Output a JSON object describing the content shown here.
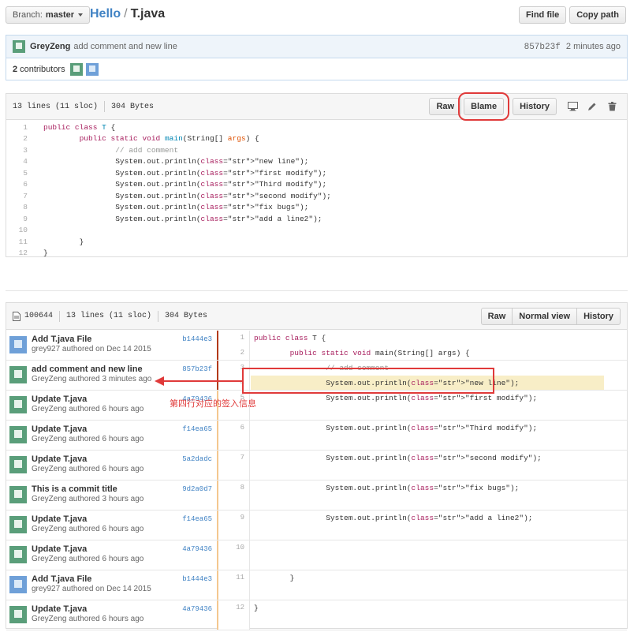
{
  "header": {
    "branch_label": "Branch:",
    "branch_name": "master",
    "repo": "Hello",
    "separator": "/",
    "file": "T.java",
    "find_file": "Find file",
    "copy_path": "Copy path"
  },
  "latest_commit": {
    "author": "GreyZeng",
    "message": "add comment and new line",
    "sha": "857b23f",
    "time": "2 minutes ago"
  },
  "contributors": {
    "count": "2",
    "label": "contributors"
  },
  "file_info": {
    "lines": "13 lines (11 sloc)",
    "size": "304 Bytes",
    "raw": "Raw",
    "blame": "Blame",
    "history": "History"
  },
  "code_lines": [
    {
      "n": "1",
      "text": "public class T {"
    },
    {
      "n": "2",
      "text": "        public static void main(String[] args) {"
    },
    {
      "n": "3",
      "text": "                // add comment"
    },
    {
      "n": "4",
      "text": "                System.out.println(\"new line\");"
    },
    {
      "n": "5",
      "text": "                System.out.println(\"first modify\");"
    },
    {
      "n": "6",
      "text": "                System.out.println(\"Third modify\");"
    },
    {
      "n": "7",
      "text": "                System.out.println(\"second modify\");"
    },
    {
      "n": "8",
      "text": "                System.out.println(\"fix bugs\");"
    },
    {
      "n": "9",
      "text": "                System.out.println(\"add a line2\");"
    },
    {
      "n": "10",
      "text": ""
    },
    {
      "n": "11",
      "text": "        }"
    },
    {
      "n": "12",
      "text": "}"
    }
  ],
  "blame_info": {
    "mode": "100644",
    "lines": "13 lines (11 sloc)",
    "size": "304 Bytes",
    "raw": "Raw",
    "normal_view": "Normal view",
    "history": "History"
  },
  "blame_rows": [
    {
      "title": "Add T.java File",
      "meta": "grey927 authored on Dec 14 2015",
      "sha": "b1444e3",
      "avatar": "blue",
      "bar": "dark",
      "lines": [
        {
          "n": "1",
          "code": "public class T {"
        },
        {
          "n": "2",
          "code": "        public static void main(String[] args) {"
        }
      ]
    },
    {
      "title": "add comment and new line",
      "meta": "GreyZeng authored 3 minutes ago",
      "sha": "857b23f",
      "avatar": "green",
      "bar": "dark",
      "lines": [
        {
          "n": "3",
          "code": "                // add comment"
        },
        {
          "n": "4",
          "code": "                System.out.println(\"new line\");"
        }
      ]
    },
    {
      "title": "Update T.java",
      "meta": "GreyZeng authored 6 hours ago",
      "sha": "4a79436",
      "avatar": "green",
      "bar": "light",
      "lines": [
        {
          "n": "5",
          "code": "                System.out.println(\"first modify\");"
        }
      ]
    },
    {
      "title": "Update T.java",
      "meta": "GreyZeng authored 6 hours ago",
      "sha": "f14ea65",
      "avatar": "green",
      "bar": "light",
      "lines": [
        {
          "n": "6",
          "code": "                System.out.println(\"Third modify\");"
        }
      ]
    },
    {
      "title": "Update T.java",
      "meta": "GreyZeng authored 6 hours ago",
      "sha": "5a2dadc",
      "avatar": "green",
      "bar": "light",
      "lines": [
        {
          "n": "7",
          "code": "                System.out.println(\"second modify\");"
        }
      ]
    },
    {
      "title": "This is a commit title",
      "meta": "GreyZeng authored 3 hours ago",
      "sha": "9d2a0d7",
      "avatar": "green",
      "bar": "light",
      "lines": [
        {
          "n": "8",
          "code": "                System.out.println(\"fix bugs\");"
        }
      ]
    },
    {
      "title": "Update T.java",
      "meta": "GreyZeng authored 6 hours ago",
      "sha": "f14ea65",
      "avatar": "green",
      "bar": "light",
      "lines": [
        {
          "n": "9",
          "code": "                System.out.println(\"add a line2\");"
        }
      ]
    },
    {
      "title": "Update T.java",
      "meta": "GreyZeng authored 6 hours ago",
      "sha": "4a79436",
      "avatar": "green",
      "bar": "light",
      "lines": [
        {
          "n": "10",
          "code": ""
        }
      ]
    },
    {
      "title": "Add T.java File",
      "meta": "grey927 authored on Dec 14 2015",
      "sha": "b1444e3",
      "avatar": "blue",
      "bar": "light",
      "lines": [
        {
          "n": "11",
          "code": "        }"
        }
      ]
    },
    {
      "title": "Update T.java",
      "meta": "GreyZeng authored 6 hours ago",
      "sha": "4a79436",
      "avatar": "green",
      "bar": "light",
      "lines": [
        {
          "n": "12",
          "code": "}"
        }
      ]
    }
  ],
  "annotation": "第四行对应的签入信息",
  "colors": {
    "link": "#4183c4",
    "annotation_red": "#e03a3a",
    "highlight_line": "#f8eec7"
  }
}
